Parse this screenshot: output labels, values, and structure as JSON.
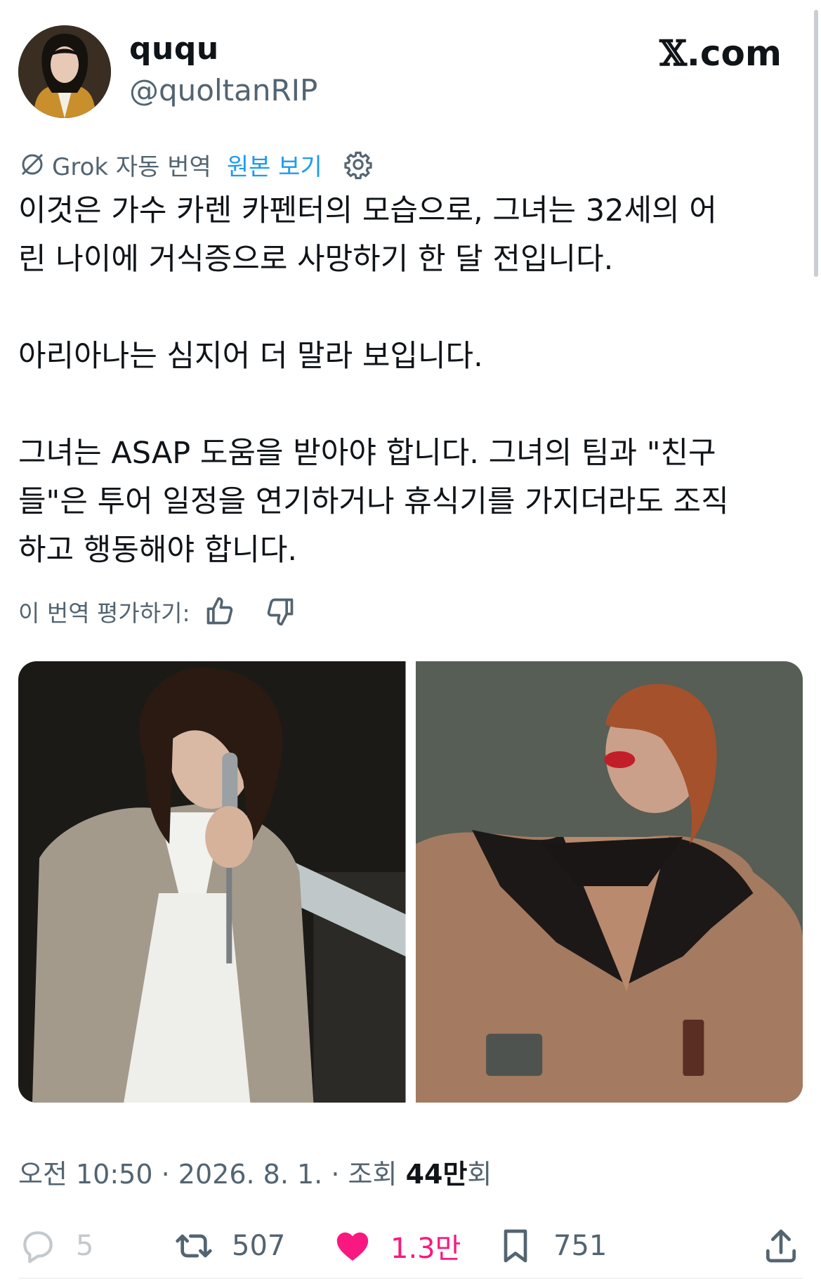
{
  "user": {
    "display_name": "ququ",
    "handle": "@quoltanRIP"
  },
  "brand": {
    "x_mark": "𝕏",
    "domain": ".com"
  },
  "translation": {
    "label": "Grok 자동 번역",
    "show_original": "원본 보기"
  },
  "tweet": {
    "text": "이것은 가수 카렌 카펜터의 모습으로, 그녀는 32세의 어\n린 나이에 거식증으로 사망하기 한 달 전입니다.\n\n아리아나는 심지어 더 말라 보입니다.\n\n그녀는 ASAP 도움을 받아야 합니다. 그녀의 팀과 \"친구\n들\"은 투어 일정을 연기하거나 휴식기를 가지더라도 조직\n하고 행동해야 합니다."
  },
  "rating": {
    "label": "이 번역 평가하기:"
  },
  "meta": {
    "time": "오전 10:50",
    "date": "2026. 8. 1.",
    "views_prefix": "조회",
    "views_count": "44만",
    "views_suffix": "회",
    "separator": "·"
  },
  "actions": {
    "replies": "5",
    "reposts": "507",
    "likes": "1.3만",
    "bookmarks": "751"
  },
  "colors": {
    "accent": "#1d9bf0",
    "like": "#f91880",
    "secondary_text": "#536471"
  }
}
